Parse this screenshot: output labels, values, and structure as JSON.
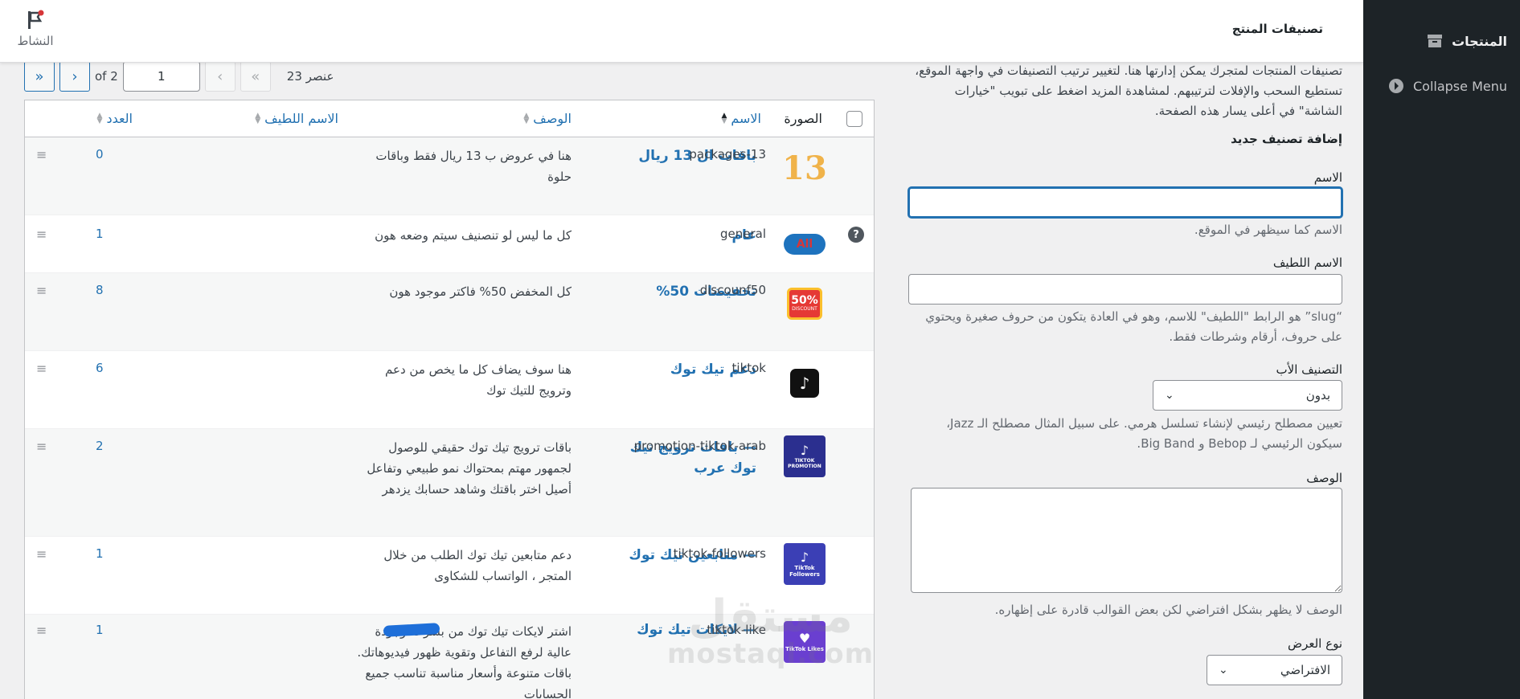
{
  "sidebar": {
    "products_label": "المنتجات",
    "collapse_label": "Collapse Menu"
  },
  "header": {
    "title": "تصنيفات المنتج",
    "activity_label": "النشاط"
  },
  "pagination": {
    "count_text": "23 عنصر",
    "first": "«",
    "prev": "‹",
    "current_page": "1",
    "of_text": "of 2",
    "next": "›",
    "last": "»"
  },
  "table": {
    "columns": {
      "image": "الصورة",
      "name": "الاسم",
      "description": "الوصف",
      "slug": "الاسم اللطيف",
      "count": "العدد"
    },
    "rows": [
      {
        "name": "باقات ال 13 ريال",
        "description": "هنا في عروض ب 13 ريال فقط وباقات حلوة",
        "slug": "packages-13",
        "count": "0",
        "thumb": "13-number-icon"
      },
      {
        "name": "عام",
        "description": "كل ما ليس لو تنصنيف سيتم وضعه هون",
        "slug": "general",
        "count": "1",
        "thumb": "all-cloud-icon"
      },
      {
        "name": "تخفيضات 50%",
        "description": "كل المخفض 50% فاكتر موجود هون",
        "slug": "discounf50",
        "count": "8",
        "thumb": "discount-badge-icon"
      },
      {
        "name": "دعم تيك توك",
        "description": "هنا سوف يضاف كل ما يخص من دعم وترويج للتيك توك",
        "slug": "tiktok",
        "count": "6",
        "thumb": "tiktok-icon"
      },
      {
        "name": "— باقات ترويج تيك توك عرب",
        "description": "باقات ترويج تيك توك حقيقي للوصول لجمهور مهتم بمحتواك نمو طبيعي وتفاعل أصيل اختر باقتك وشاهد حسابك يزدهر",
        "slug": "promotion-tiktok-arab",
        "count": "2",
        "thumb": "tiktok-promotion-icon"
      },
      {
        "name": "— متابعين تيك توك",
        "description": "دعم متابعين تيك توك الطلب من خلال المتجر ، الواتساب للشكاوى",
        "slug": "tiktok-followers",
        "count": "1",
        "thumb": "tiktok-followers-icon"
      },
      {
        "name": "— لايكات تيك توك",
        "description": "اشتر لايكات تيك توك من بسرعة وجودة عالية لرفع التفاعل وتقوية ظهور فيديوهاتك. باقات متنوعة وأسعار مناسبة تناسب جميع الحسابات",
        "slug": "tiktok-like",
        "count": "1",
        "thumb": "tiktok-likes-icon"
      }
    ],
    "thumb_text": {
      "n13": "13",
      "all": "All",
      "fifty": "50%",
      "disc": "DISCOUNT",
      "promo": "TIKTOK PROMOTION",
      "followers": "TikTok Followers",
      "likes": "TikTok Likes"
    }
  },
  "form": {
    "intro": "تصنيفات المنتجات لمتجرك يمكن إدارتها هنا. لتغيير ترتيب التصنيفات في واجهة الموقع، تستطيع السحب والإفلات لترتيبهم. لمشاهدة المزيد اضغط على تبويب \"خيارات الشاشة\" في أعلى يسار هذه الصفحة.",
    "add_title": "إضافة تصنيف جديد",
    "name_label": "الاسم",
    "name_value": "",
    "name_hint": "الاسم كما سيظهر في الموقع.",
    "slug_label": "الاسم اللطيف",
    "slug_value": "",
    "slug_hint": "“slug” هو الرابط \"اللطيف\" للاسم، وهو في العادة يتكون من حروف صغيرة ويحتوي على حروف، أرقام وشرطات فقط.",
    "parent_label": "التصنيف الأب",
    "parent_value": "بدون",
    "parent_hint": "تعيين مصطلح رئيسي لإنشاء تسلسل هرمي. على سبيل المثال مصطلح الـ Jazz، سيكون الرئيسي لـ Bebop و Big Band.",
    "desc_label": "الوصف",
    "desc_value": "",
    "desc_hint": "الوصف لا يظهر بشكل افتراضي لكن بعض القوالب قادرة على إظهاره.",
    "display_label": "نوع العرض",
    "display_value": "الافتراضي"
  },
  "watermark": {
    "ar": "مستقل",
    "en": "mostaql.com"
  },
  "colors": {
    "accent": "#2271b1",
    "sidebar": "#1d2327"
  }
}
